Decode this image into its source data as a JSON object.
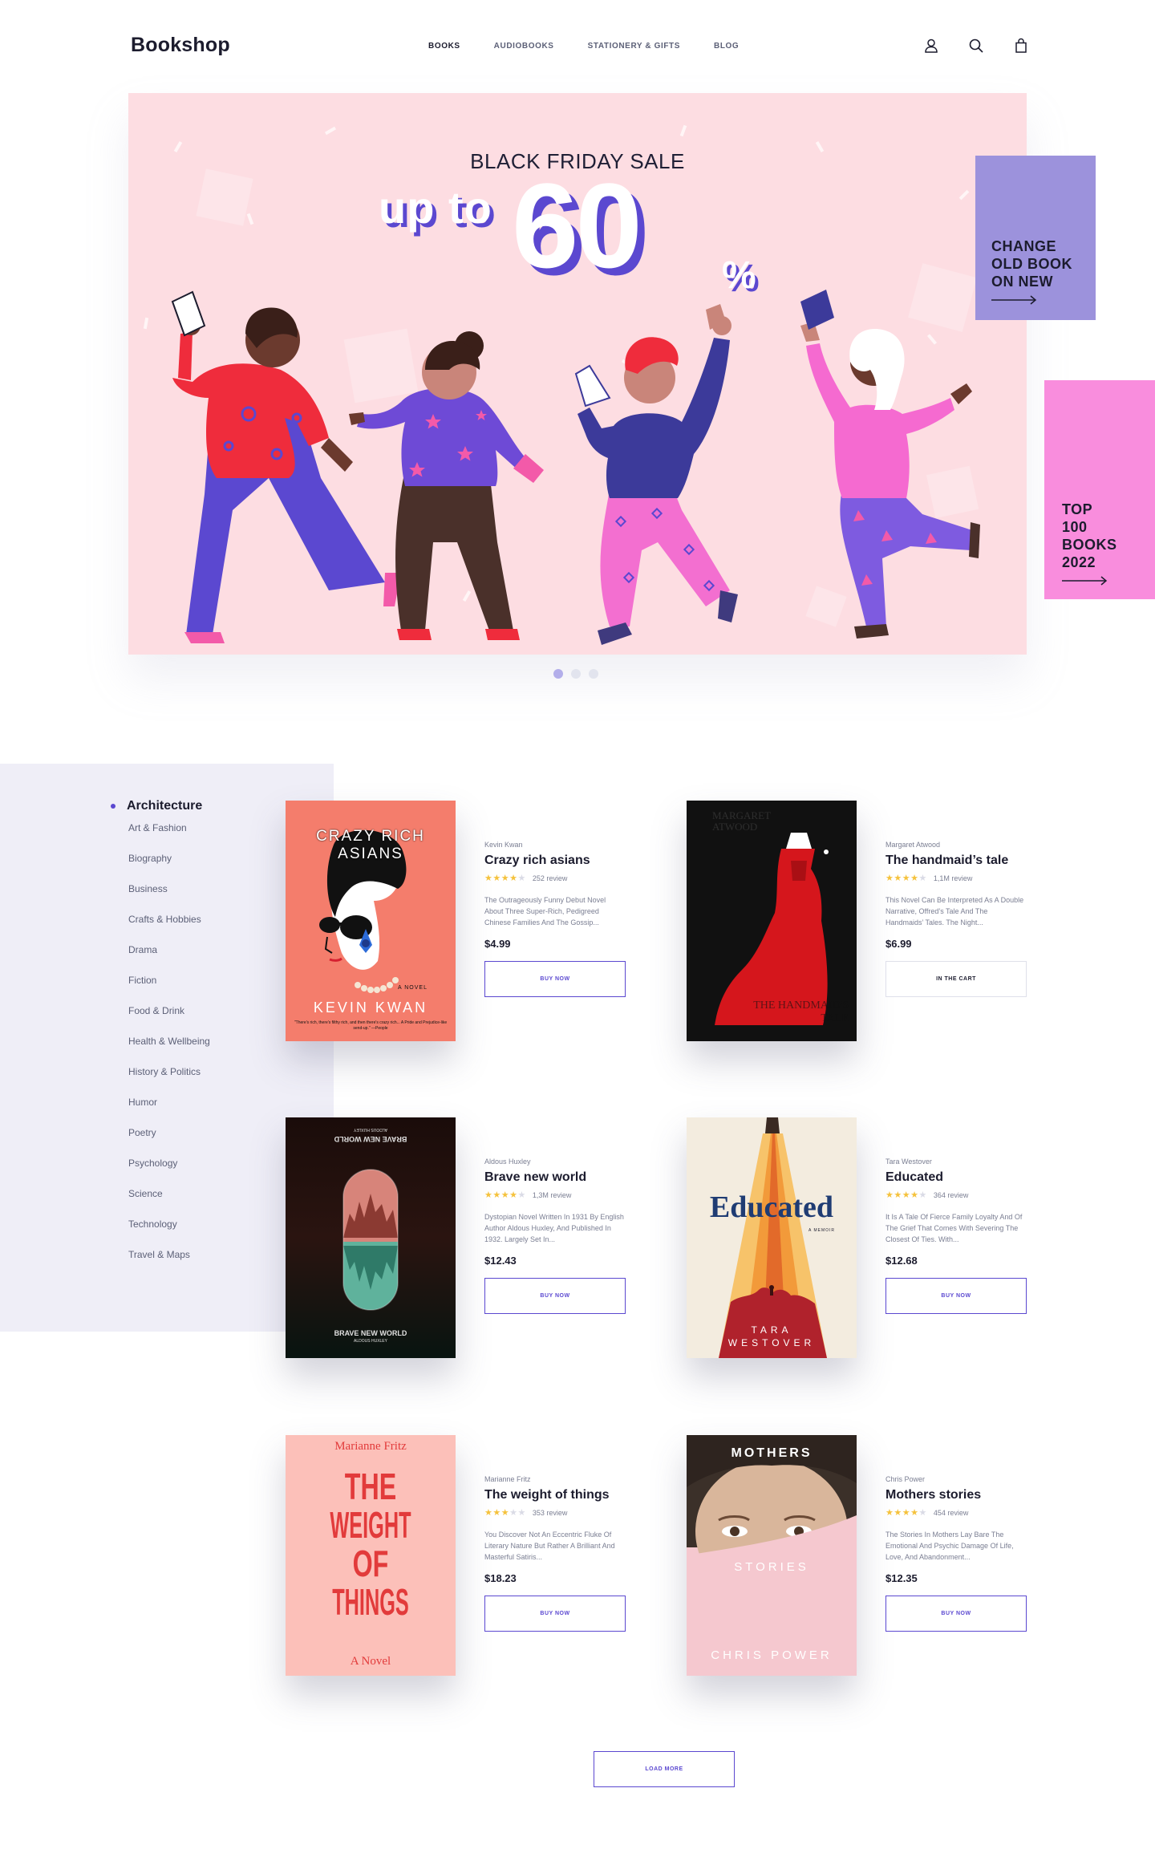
{
  "header": {
    "logo": "Bookshop",
    "nav": [
      "BOOKS",
      "AUDIOBOOKS",
      "STATIONERY & GIFTS",
      "BLOG"
    ],
    "active_nav": "BOOKS",
    "icons": [
      "user-icon",
      "search-icon",
      "bag-icon"
    ]
  },
  "hero": {
    "title": "BLACK FRIDAY SALE",
    "upto": "up to",
    "amount": "60",
    "percent": "%",
    "slides": 3,
    "active_slide": 1
  },
  "promos": {
    "change": "CHANGE\nOLD BOOK\nON NEW",
    "top": "TOP\n100\nBOOKS\n2022"
  },
  "sidebar": {
    "active": "Architecture",
    "items": [
      "Art & Fashion",
      "Biography",
      "Business",
      "Crafts & Hobbies",
      "Drama",
      "Fiction",
      "Food & Drink",
      "Health & Wellbeing",
      "History & Politics",
      "Humor",
      "Poetry",
      "Psychology",
      "Science",
      "Technology",
      "Travel & Maps"
    ]
  },
  "books": [
    {
      "author": "Kevin Kwan",
      "title": "Crazy rich asians",
      "rating": 4,
      "reviews": "252 review",
      "desc": "The Outrageously Funny Debut Novel About Three Super-Rich, Pedigreed Chinese Families And The Gossip...",
      "price": "$4.99",
      "button": "BUY NOW",
      "cover": {
        "top": "CRAZY RICH ASIANS",
        "mid": "A NOVEL",
        "bottom": "KEVIN KWAN",
        "quote": "\"There's rich, there's filthy rich, and then there's crazy rich... A Pride and Prejudice-like send-up.\" —People"
      }
    },
    {
      "author": "Margaret Atwood",
      "title": "The handmaid’s tale",
      "rating": 4,
      "reviews": "1,1M review",
      "desc": "This Novel Can Be Interpreted As A Double Narrative, Offred’s Tale And The Handmaids’ Tales. The Night...",
      "price": "$6.99",
      "button": "IN THE CART",
      "cover": {
        "top": "MARGARET ATWOOD",
        "bottom": "THE HANDMAID'S TALE"
      }
    },
    {
      "author": "Aldous Huxley",
      "title": "Brave new world",
      "rating": 4,
      "reviews": "1,3M review",
      "desc": "Dystopian Novel Written In 1931 By English Author Aldous Huxley, And Published In 1932. Largely Set In...",
      "price": "$12.43",
      "button": "BUY NOW",
      "cover": {
        "top": "BRAVE NEW WORLD",
        "top_small": "ALDOUS HUXLEY",
        "bottom": "BRAVE NEW WORLD",
        "bottom_small": "ALDOUS HUXLEY"
      }
    },
    {
      "author": "Tara Westover",
      "title": "Educated",
      "rating": 4,
      "reviews": "364 review",
      "desc": "It Is A Tale Of Fierce Family Loyalty And Of The Grief That Comes With Severing The Closest Of Ties. With...",
      "price": "$12.68",
      "button": "BUY NOW",
      "cover": {
        "top": "Educated",
        "mid": "A MEMOIR",
        "bottom1": "TARA",
        "bottom2": "WESTOVER"
      }
    },
    {
      "author": "Marianne Fritz",
      "title": "The weight of things",
      "rating": 3,
      "reviews": "353 review",
      "desc": "You Discover Not An Eccentric Fluke Of Literary Nature But Rather A Brilliant And Masterful Satiris...",
      "price": "$18.23",
      "button": "BUY NOW",
      "cover": {
        "top": "Marianne Fritz",
        "w1": "THE",
        "w2": "WEIGHT",
        "w3": "OF",
        "w4": "THINGS",
        "bottom": "A Novel"
      }
    },
    {
      "author": "Chris Power",
      "title": "Mothers stories",
      "rating": 4,
      "reviews": "454 review",
      "desc": "The Stories In Mothers Lay Bare The Emotional And Psychic Damage Of Life, Love, And Abandonment...",
      "price": "$12.35",
      "button": "BUY NOW",
      "cover": {
        "top": "MOTHERS",
        "mid": "STORIES",
        "bottom": "CHRIS POWER"
      }
    }
  ],
  "load_more": "LOAD MORE",
  "colors": {
    "accent": "#5b48d0",
    "hero_bg": "#fddde2",
    "promo_purple": "#9c92dc",
    "promo_pink": "#f98ddd",
    "sidebar_bg": "#efeef7",
    "star": "#f5c23c"
  }
}
